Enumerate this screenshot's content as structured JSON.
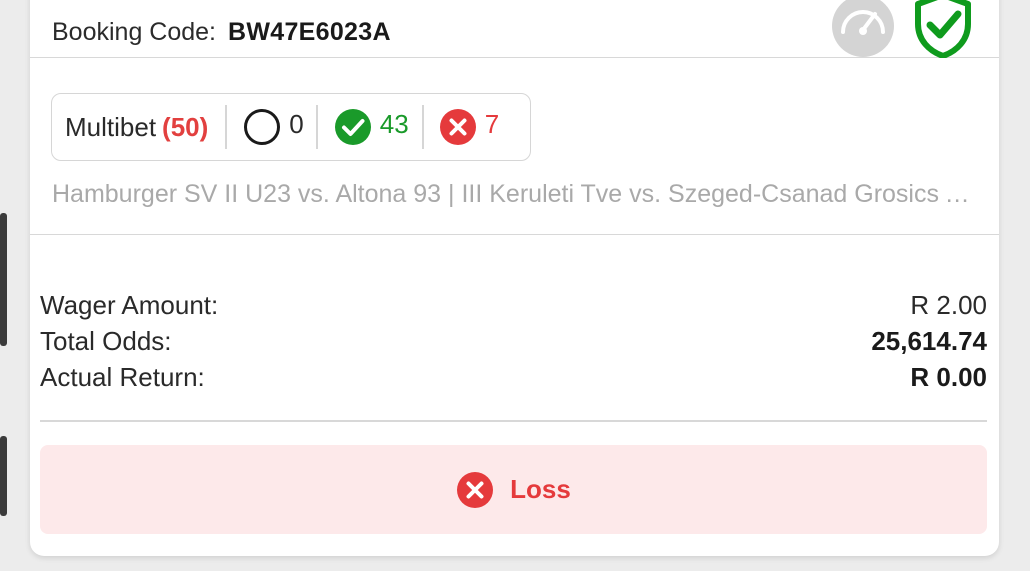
{
  "booking": {
    "label": "Booking Code:",
    "code": "BW47E6023A",
    "icons": [
      "speedometer-icon",
      "shield-check-icon"
    ]
  },
  "bet_summary": {
    "type_label": "Multibet",
    "total": "(50)",
    "pending": "0",
    "won": "43",
    "lost": "7",
    "matches": "Hamburger SV II U23 vs. Altona 93 | III Keruleti Tve vs. Szeged-Csanad Grosics Akademia"
  },
  "totals": {
    "wager_label": "Wager Amount:",
    "wager_value": "R 2.00",
    "odds_label": "Total Odds:",
    "odds_value": "25,614.74",
    "return_label": "Actual Return:",
    "return_value": "R 0.00"
  },
  "result": {
    "label": "Loss",
    "icon": "x-circle-icon"
  },
  "colors": {
    "loss_red": "#e53a3c",
    "win_green": "#1a9a2a",
    "shield_green": "#0f9b1d",
    "loss_bg": "#fde9ea"
  }
}
